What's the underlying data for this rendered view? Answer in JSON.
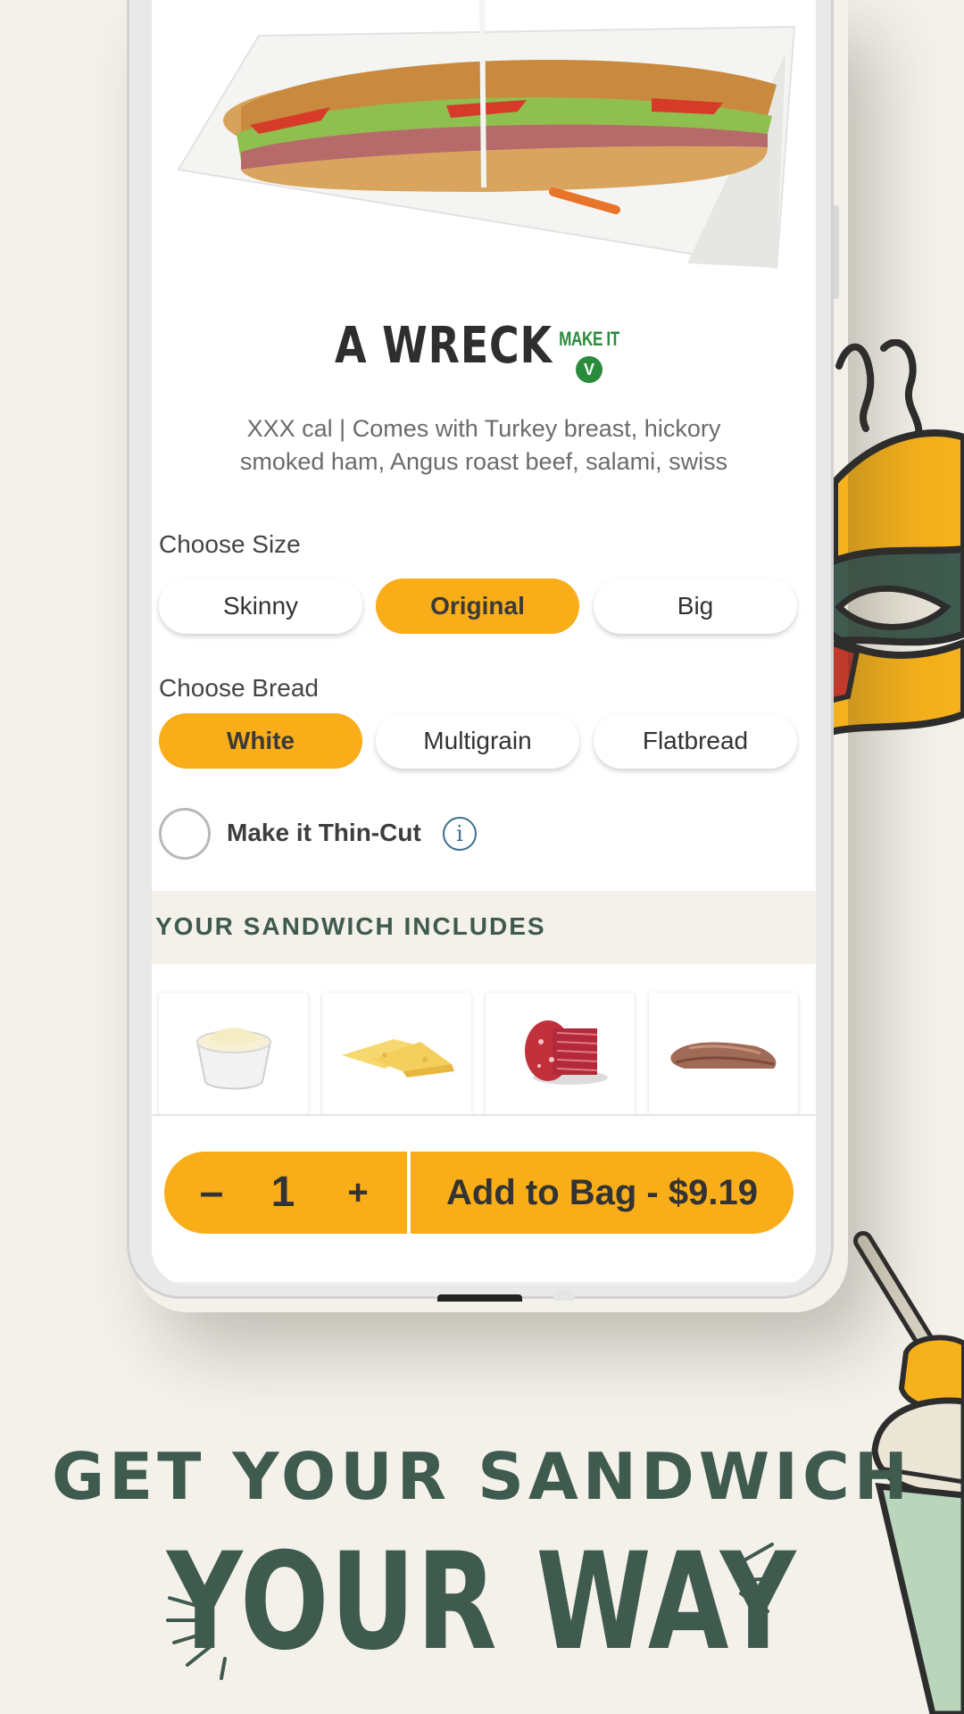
{
  "product": {
    "title": "A WRECK",
    "veg_badge_label": "MAKE IT",
    "veg_badge_letter": "V",
    "description": "XXX cal | Comes with Turkey breast, hickory smoked ham, Angus roast beef, salami, swiss"
  },
  "size": {
    "label": "Choose Size",
    "options": [
      "Skinny",
      "Original",
      "Big"
    ],
    "selected": "Original"
  },
  "bread": {
    "label": "Choose Bread",
    "options": [
      "White",
      "Multigrain",
      "Flatbread"
    ],
    "selected": "White"
  },
  "thin_cut": {
    "label": "Make it Thin-Cut",
    "checked": false,
    "info_icon": "i"
  },
  "includes": {
    "label": "YOUR SANDWICH INCLUDES",
    "items": [
      "mayo-cup",
      "swiss-cheese",
      "salami",
      "roast-beef"
    ]
  },
  "cart": {
    "minus": "–",
    "quantity": "1",
    "plus": "+",
    "add_label": "Add to Bag - $9.19"
  },
  "promo": {
    "line1": "GET YOUR SANDWICH",
    "line2": "YOUR WAY"
  },
  "colors": {
    "accent": "#f9ad19",
    "brand_green": "#3f5a4e",
    "veg_green": "#2a8b3c",
    "background": "#f3f1ea"
  }
}
